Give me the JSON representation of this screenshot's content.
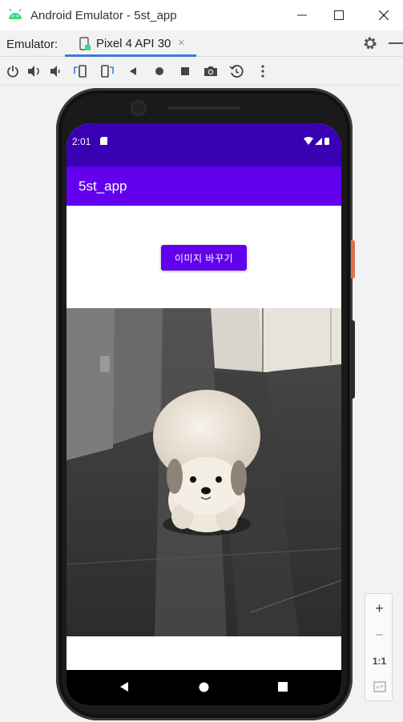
{
  "window": {
    "title": "Android Emulator - 5st_app"
  },
  "tabbar": {
    "label": "Emulator:",
    "tab_label": "Pixel 4 API 30",
    "tab_close": "×"
  },
  "toolbar": {
    "icons": [
      "power-icon",
      "volume-up-icon",
      "volume-down-icon",
      "rotate-left-icon",
      "rotate-right-icon",
      "back-icon",
      "home-icon",
      "overview-icon",
      "camera-icon",
      "snapshot-icon",
      "more-icon"
    ]
  },
  "status_bar": {
    "time": "2:01"
  },
  "app": {
    "title": "5st_app",
    "button_label": "이미지 바꾸기",
    "primary_color": "#6200ee",
    "status_color": "#3a00b4"
  },
  "zoom": {
    "plus": "+",
    "minus": "−",
    "one_to_one": "1:1"
  }
}
